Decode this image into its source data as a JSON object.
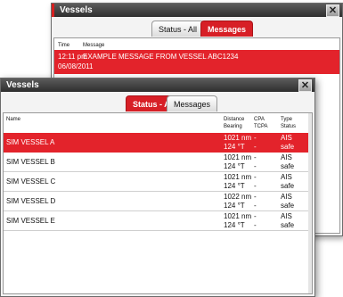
{
  "back_window": {
    "title": "Vessels",
    "close_label": "✕",
    "tabs": [
      {
        "label": "Status - All",
        "active": false
      },
      {
        "label": "Messages",
        "active": true
      }
    ],
    "columns": {
      "time": "Time",
      "message": "Message"
    },
    "rows": [
      {
        "time": "12:11 pm",
        "date": "06/08/2011",
        "message": "EXAMPLE MESSAGE FROM VESSEL ABC1234",
        "selected": true
      }
    ]
  },
  "front_window": {
    "title": "Vessels",
    "close_label": "✕",
    "tabs": [
      {
        "label": "Status - All",
        "active": true
      },
      {
        "label": "Messages",
        "active": false
      }
    ],
    "columns": {
      "name": "Name",
      "distance": "Distance",
      "bearing": "Bearing",
      "cpa": "CPA",
      "tcpa": "TCPA",
      "type": "Type",
      "status": "Status"
    },
    "vessels": [
      {
        "name": "SIM VESSEL A",
        "distance": "1021 nm",
        "bearing": "124 °T",
        "cpa": "-",
        "tcpa": "-",
        "type": "AIS",
        "status": "safe",
        "selected": true
      },
      {
        "name": "SIM VESSEL B",
        "distance": "1021 nm",
        "bearing": "124 °T",
        "cpa": "-",
        "tcpa": "-",
        "type": "AIS",
        "status": "safe",
        "selected": false
      },
      {
        "name": "SIM VESSEL C",
        "distance": "1021 nm",
        "bearing": "124 °T",
        "cpa": "-",
        "tcpa": "-",
        "type": "AIS",
        "status": "safe",
        "selected": false
      },
      {
        "name": "SIM VESSEL D",
        "distance": "1022 nm",
        "bearing": "124 °T",
        "cpa": "-",
        "tcpa": "-",
        "type": "AIS",
        "status": "safe",
        "selected": false
      },
      {
        "name": "SIM VESSEL E",
        "distance": "1021 nm",
        "bearing": "124 °T",
        "cpa": "-",
        "tcpa": "-",
        "type": "AIS",
        "status": "safe",
        "selected": false
      }
    ]
  },
  "colors": {
    "accent": "#e3232b",
    "titlebar": "#3a3a3a"
  }
}
